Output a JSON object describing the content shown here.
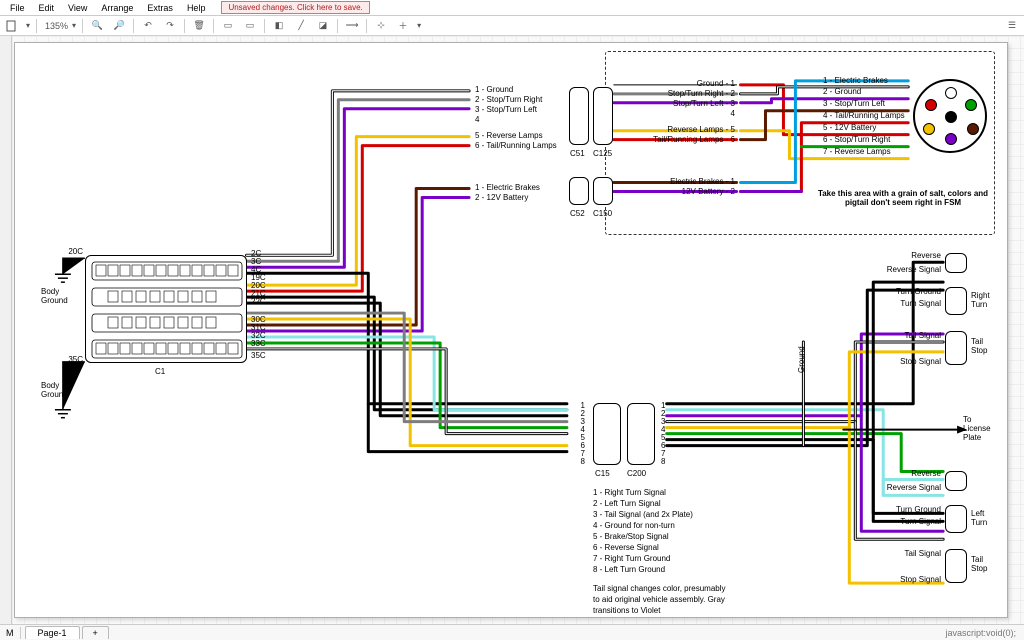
{
  "menu": {
    "file": "File",
    "edit": "Edit",
    "view": "View",
    "arrange": "Arrange",
    "extras": "Extras",
    "help": "Help",
    "warn": "Unsaved changes. Click here to save."
  },
  "toolbar": {
    "zoom": "135%"
  },
  "tabs": {
    "m": "M",
    "page1": "Page-1",
    "plus": "+"
  },
  "status_right": "javascript:void(0);",
  "left": {
    "body_ground_1": "Body\nGround",
    "body_ground_2": "Body\nGround",
    "c1": "C1",
    "pins": {
      "p20C": "20C",
      "p35C": "35C",
      "p2C": "2C",
      "p3C": "3C",
      "p4C": "4C",
      "p19C": "19C",
      "p20Cb": "20C",
      "p21C": "21C",
      "p22C": "22C",
      "p30C": "30C",
      "p31C": "31C",
      "p32C": "32C",
      "p33C": "33C",
      "p35Cb": "35C"
    }
  },
  "top_group": {
    "l1": "1 - Ground",
    "l2": "2 - Stop/Turn Right",
    "l3": "3 - Stop/Turn Left",
    "l4": "4",
    "l5": "5 - Reverse Lamps",
    "l6": "6 - Tail/Running Lamps",
    "eb": "1 - Electric Brakes",
    "bv": "2 - 12V Battery",
    "c51": "C51",
    "c52": "C52",
    "c125": "C125",
    "c150": "C150"
  },
  "dashed": {
    "g1": "Ground - 1",
    "s2": "Stop/Turn Right - 2",
    "s3": "Stop/Turn Left - 3",
    "n4": "4",
    "r5": "Reverse Lamps - 5",
    "t6": "Tail/Running Lamps - 6",
    "eb1": "Electric Brakes - 1",
    "bv2": "12V Battery - 2",
    "r_eb": "1 - Electric Brakes",
    "r_g": "2 - Ground",
    "r_stl": "3 - Stop/Turn Left",
    "r_trl": "4 - Tail/Running Lamps",
    "r_12v": "5 - 12V Battery",
    "r_str": "6 - Stop/Turn Right",
    "r_rev": "7 - Reverse Lamps",
    "note": "Take this area with a grain of salt, colors and pigtail don't seem right in FSM"
  },
  "mid": {
    "n1": "1",
    "n2": "2",
    "n3": "3",
    "n4": "4",
    "n5": "5",
    "n6": "6",
    "n7": "7",
    "n8": "8",
    "c15": "C15",
    "c200": "C200",
    "legend": {
      "l1": "1 - Right Turn Signal",
      "l2": "2 - Left Turn Signal",
      "l3": "3 - Tail Signal (and 2x Plate)",
      "l4": "4 - Ground for non-turn",
      "l5": "5 - Brake/Stop Signal",
      "l6": "6 - Reverse Signal",
      "l7": "7 - Right Turn Ground",
      "l8": "8 - Left Turn Ground",
      "note": "Tail signal changes color, presumably to aid original vehicle assembly. Gray transitions to Violet"
    }
  },
  "right": {
    "reverse": "Reverse",
    "reverse_signal": "Reverse Signal",
    "turn_ground": "Turn Ground",
    "turn_signal": "Turn Signal",
    "right_turn": "Right\nTurn",
    "left_turn": "Left\nTurn",
    "tail_signal": "Tail Signal",
    "tail_stop": "Tail\nStop",
    "stop_signal": "Stop Signal",
    "ground": "Ground",
    "license": "To\nLicense\nPlate"
  }
}
